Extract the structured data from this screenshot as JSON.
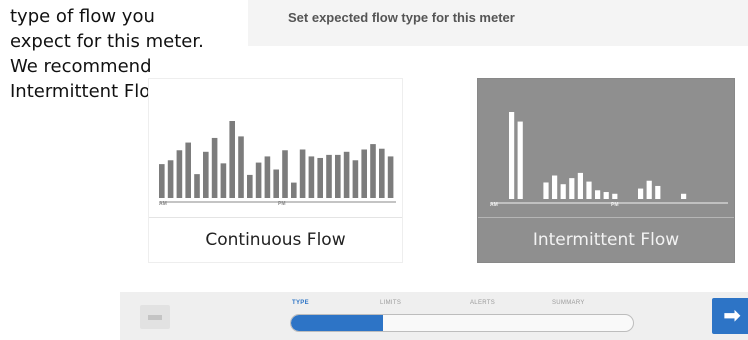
{
  "instruction": {
    "lines": [
      "type of flow you",
      "expect for this meter.",
      "We recommend",
      "Intermittent Flow."
    ]
  },
  "screen": {
    "title": "Set expected flow type for this meter"
  },
  "options": [
    {
      "label": "Continuous Flow",
      "axis_am": "AM",
      "axis_pm": "PM",
      "bar_levels": [
        0.44,
        0.49,
        0.62,
        0.72,
        0.31,
        0.6,
        0.78,
        0.45,
        1.0,
        0.8,
        0.3,
        0.46,
        0.54,
        0.37,
        0.62,
        0.2,
        0.63,
        0.54,
        0.52,
        0.56,
        0.56,
        0.6,
        0.49,
        0.63,
        0.7,
        0.64,
        0.54
      ]
    },
    {
      "label": "Intermittent Flow",
      "axis_am": "AM",
      "axis_pm": "PM",
      "bar_levels": [
        1.0,
        0.89,
        0.0,
        0.0,
        0.19,
        0.27,
        0.17,
        0.24,
        0.3,
        0.2,
        0.1,
        0.08,
        0.06,
        0.0,
        0.0,
        0.12,
        0.21,
        0.15,
        0.0,
        0.0,
        0.06
      ]
    }
  ],
  "progress": {
    "steps": [
      "TYPE",
      "LIMITS",
      "ALERTS",
      "SUMMARY"
    ],
    "active_step": "TYPE",
    "fill_fraction": 0.27
  },
  "colors": {
    "accent": "#2d74c6",
    "selected_card_bg": "#8f8f8f",
    "bar_dark": "#7c7c7c",
    "bar_light": "#ffffff"
  },
  "icons": {
    "back": "back-arrow-icon",
    "next": "next-arrow-icon",
    "next_glyph": "➡"
  }
}
